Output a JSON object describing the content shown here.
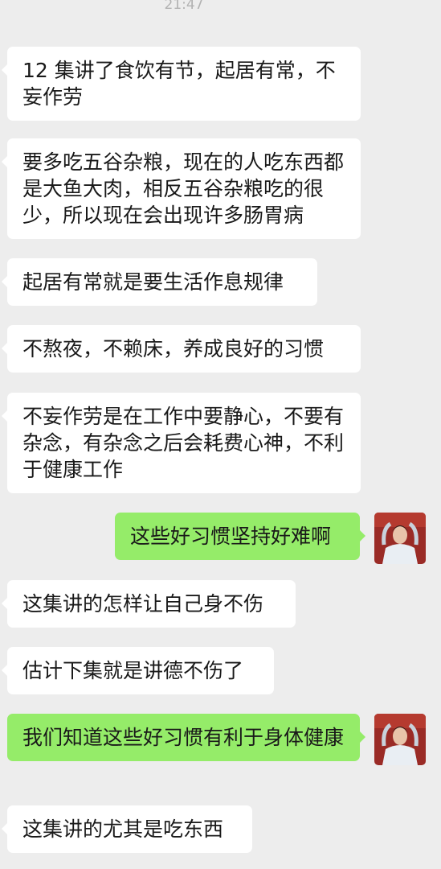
{
  "chat": {
    "timestamp": "21:47",
    "messages": [
      {
        "side": "in",
        "text": "12 集讲了食饮有节，起居有常，不妄作劳"
      },
      {
        "side": "in",
        "text": "要多吃五谷杂粮，现在的人吃东西都是大鱼大肉，相反五谷杂粮吃的很少，所以现在会出现许多肠胃病"
      },
      {
        "side": "in",
        "text": "起居有常就是要生活作息规律"
      },
      {
        "side": "in",
        "text": "不熬夜，不赖床，养成良好的习惯"
      },
      {
        "side": "in",
        "text": "不妄作劳是在工作中要静心，不要有杂念，有杂念之后会耗费心神，不利于健康工作"
      },
      {
        "side": "out",
        "text": "这些好习惯坚持好难啊"
      },
      {
        "side": "in",
        "text": "这集讲的怎样让自己身不伤"
      },
      {
        "side": "in",
        "text": "估计下集就是讲德不伤了"
      },
      {
        "side": "out",
        "text": "我们知道这些好习惯有利于身体健康"
      },
      {
        "side": "in",
        "text": "这集讲的尤其是吃东西"
      }
    ]
  },
  "colors": {
    "background": "#ededed",
    "incoming_bubble": "#ffffff",
    "outgoing_bubble": "#95ec69",
    "timestamp_text": "#b2b2b2"
  },
  "icons": {
    "self_avatar": "user-avatar-photo"
  }
}
